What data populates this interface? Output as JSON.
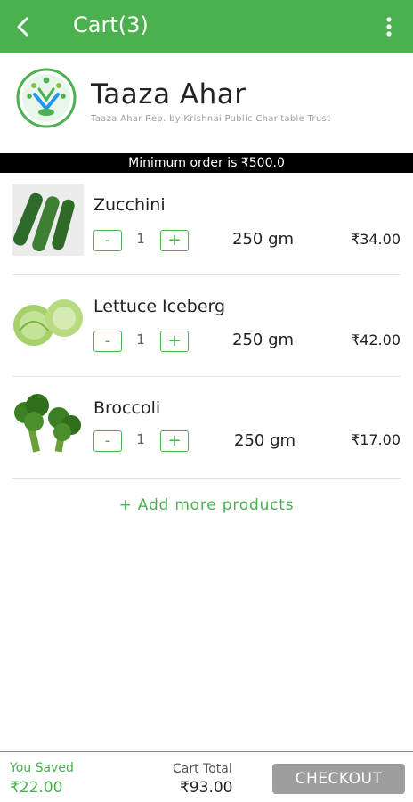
{
  "app_bar": {
    "title": "Cart(3)",
    "back_icon": "arrow-back-icon",
    "more_icon": "more-vert-icon",
    "color": "#4caf50"
  },
  "shop": {
    "name": "Taaza Ahar",
    "subtitle": "Taaza Ahar Rep. by Krishnai Public Charitable Trust",
    "logo_icon": "trust-logo-icon"
  },
  "notice": {
    "min_order": "Minimum order is ₹500.0"
  },
  "cart": {
    "items": [
      {
        "name": "Zucchini",
        "qty": "1",
        "minus": "-",
        "plus": "+",
        "weight": "250 gm",
        "price": "₹34.00",
        "image": "zucchini-image"
      },
      {
        "name": "Lettuce Iceberg",
        "qty": "1",
        "minus": "-",
        "plus": "+",
        "weight": "250 gm",
        "price": "₹42.00",
        "image": "lettuce-image"
      },
      {
        "name": "Broccoli",
        "qty": "1",
        "minus": "-",
        "plus": "+",
        "weight": "250 gm",
        "price": "₹17.00",
        "image": "broccoli-image"
      }
    ]
  },
  "add_more": "+ Add more products",
  "footer": {
    "saved_label": "You Saved",
    "saved_value": "₹22.00",
    "total_label": "Cart Total",
    "total_value": "₹93.00",
    "checkout_label": "CHECKOUT"
  },
  "colors": {
    "accent": "#4caf50",
    "notice_bg": "#000000",
    "checkout_disabled": "#9e9e9e"
  }
}
